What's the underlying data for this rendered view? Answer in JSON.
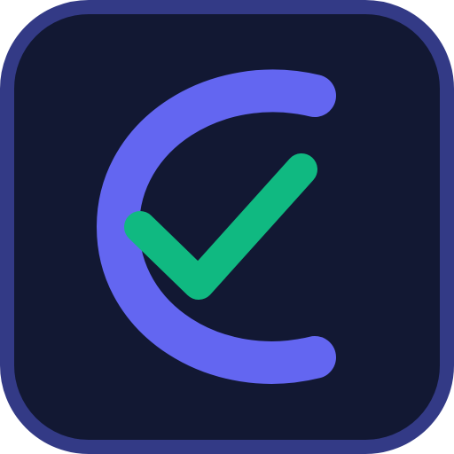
{
  "app_icon": {
    "name": "check-c-logo",
    "colors": {
      "background": "#121833",
      "border": "#333a86",
      "c_arc": "#6366f1",
      "check": "#10b981"
    }
  }
}
